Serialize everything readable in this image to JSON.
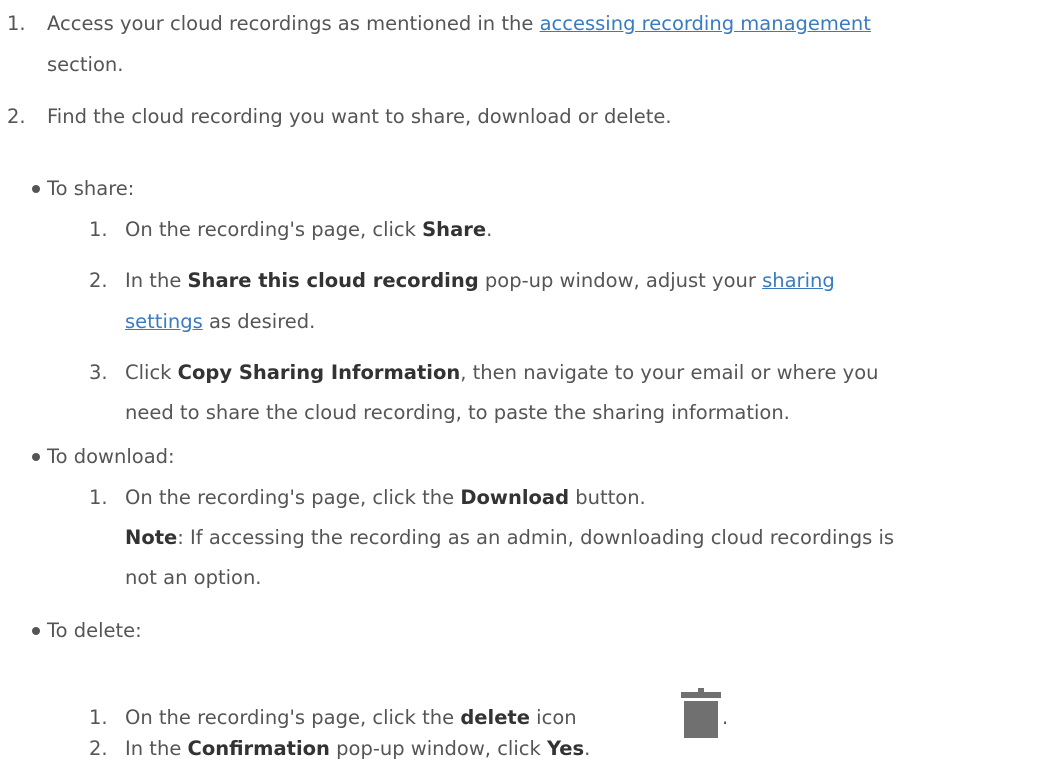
{
  "steps": [
    {
      "num": "1.",
      "line1_pre": "Access your cloud recordings as mentioned in the ",
      "line1_link": "accessing recording management",
      "line2": "section."
    },
    {
      "num": "2.",
      "text": "Find the cloud recording you want to share, download or delete."
    }
  ],
  "share": {
    "heading": "To share:",
    "step1": {
      "num": "1.",
      "pre": "On the recording's page, click ",
      "bold": "Share",
      "post": "."
    },
    "step2": {
      "num": "2.",
      "pre": "In the ",
      "bold": "Share this cloud recording",
      "mid": " pop-up window, adjust your ",
      "link1": "sharing",
      "link2": "settings",
      "post": " as desired."
    },
    "step3": {
      "num": "3.",
      "pre": "Click ",
      "bold": "Copy Sharing Information",
      "post": ", then navigate to your email or where you",
      "line2": "need to share the cloud recording, to paste the sharing information."
    }
  },
  "download": {
    "heading": "To download:",
    "step1": {
      "num": "1.",
      "pre": "On the recording's page, click the ",
      "bold": "Download",
      "post": " button.",
      "note_bold": "Note",
      "note_text": ": If accessing the recording as an admin, downloading cloud recordings is",
      "note_line2": "not an option."
    }
  },
  "delete": {
    "heading": "To delete:",
    "step1": {
      "num": "1.",
      "pre": "On the recording's page, click the ",
      "bold": "delete",
      "mid": " icon",
      "post": ".",
      "icon": "trash-icon"
    },
    "step2": {
      "num": "2.",
      "pre": "In the ",
      "bold": "Confirmation",
      "mid": " pop-up window, click ",
      "bold2": "Yes",
      "post": "."
    }
  },
  "colors": {
    "text": "#555555",
    "bold": "#333333",
    "link": "#3a7bbf",
    "icon": "#707070"
  }
}
